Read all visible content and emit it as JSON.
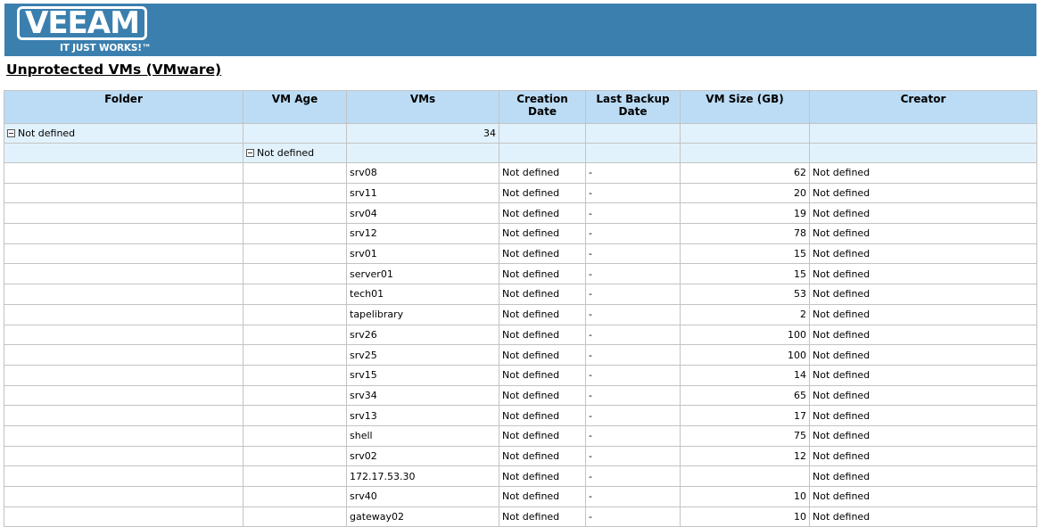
{
  "header": {
    "logo_text": "VEEAM",
    "tagline": "IT JUST WORKS!™"
  },
  "report": {
    "title": "Unprotected VMs (VMware)"
  },
  "table": {
    "columns": [
      "Folder",
      "VM Age",
      "VMs",
      "Creation Date",
      "Last Backup Date",
      "VM Size (GB)",
      "Creator"
    ],
    "group": {
      "folder": "Not defined",
      "vm_count": "34",
      "subgroup_age": "Not defined"
    },
    "rows": [
      {
        "vm": "srv08",
        "created": "Not defined",
        "last_backup": "-",
        "size": "62",
        "creator": "Not defined"
      },
      {
        "vm": "srv11",
        "created": "Not defined",
        "last_backup": "-",
        "size": "20",
        "creator": "Not defined"
      },
      {
        "vm": "srv04",
        "created": "Not defined",
        "last_backup": "-",
        "size": "19",
        "creator": "Not defined"
      },
      {
        "vm": "srv12",
        "created": "Not defined",
        "last_backup": "-",
        "size": "78",
        "creator": "Not defined"
      },
      {
        "vm": "srv01",
        "created": "Not defined",
        "last_backup": "-",
        "size": "15",
        "creator": "Not defined"
      },
      {
        "vm": "server01",
        "created": "Not defined",
        "last_backup": "-",
        "size": "15",
        "creator": "Not defined"
      },
      {
        "vm": "tech01",
        "created": "Not defined",
        "last_backup": "-",
        "size": "53",
        "creator": "Not defined"
      },
      {
        "vm": "tapelibrary",
        "created": "Not defined",
        "last_backup": "-",
        "size": "2",
        "creator": "Not defined"
      },
      {
        "vm": "srv26",
        "created": "Not defined",
        "last_backup": "-",
        "size": "100",
        "creator": "Not defined"
      },
      {
        "vm": "srv25",
        "created": "Not defined",
        "last_backup": "-",
        "size": "100",
        "creator": "Not defined"
      },
      {
        "vm": "srv15",
        "created": "Not defined",
        "last_backup": "-",
        "size": "14",
        "creator": "Not defined"
      },
      {
        "vm": "srv34",
        "created": "Not defined",
        "last_backup": "-",
        "size": "65",
        "creator": "Not defined"
      },
      {
        "vm": "srv13",
        "created": "Not defined",
        "last_backup": "-",
        "size": "17",
        "creator": "Not defined"
      },
      {
        "vm": "shell",
        "created": "Not defined",
        "last_backup": "-",
        "size": "75",
        "creator": "Not defined"
      },
      {
        "vm": "srv02",
        "created": "Not defined",
        "last_backup": "-",
        "size": "12",
        "creator": "Not defined"
      },
      {
        "vm": "172.17.53.30",
        "created": "Not defined",
        "last_backup": "-",
        "size": "",
        "creator": "Not defined"
      },
      {
        "vm": "srv40",
        "created": "Not defined",
        "last_backup": "-",
        "size": "10",
        "creator": "Not defined"
      },
      {
        "vm": "gateway02",
        "created": "Not defined",
        "last_backup": "-",
        "size": "10",
        "creator": "Not defined"
      }
    ]
  }
}
